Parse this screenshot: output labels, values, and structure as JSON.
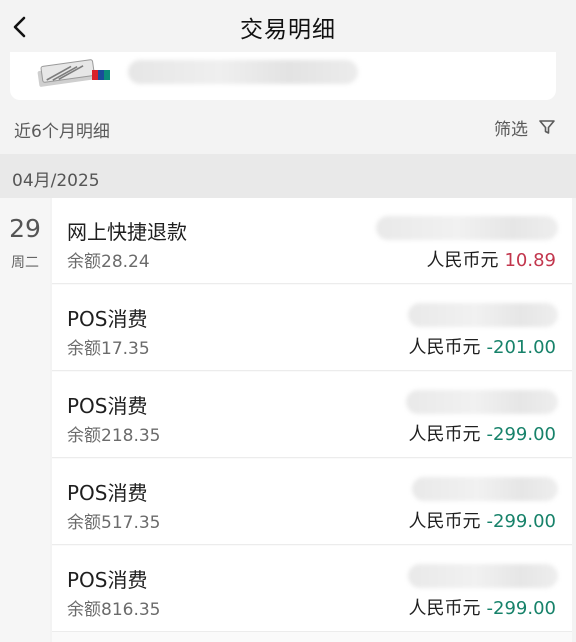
{
  "header": {
    "title": "交易明细"
  },
  "period": {
    "label": "近6个月明细",
    "filter_label": "筛选"
  },
  "month": {
    "label": "04月/2025"
  },
  "date": {
    "day": "29",
    "weekday": "周二"
  },
  "colors": {
    "income": "#c2364d",
    "expense": "#17826a"
  },
  "transactions": [
    {
      "title": "网上快捷退款",
      "balance": "余额28.24",
      "currency": "人民币元",
      "amount": "10.89",
      "type": "income"
    },
    {
      "title": "POS消费",
      "balance": "余额17.35",
      "currency": "人民币元",
      "amount": "-201.00",
      "type": "expense"
    },
    {
      "title": "POS消费",
      "balance": "余额218.35",
      "currency": "人民币元",
      "amount": "-299.00",
      "type": "expense"
    },
    {
      "title": "POS消费",
      "balance": "余额517.35",
      "currency": "人民币元",
      "amount": "-299.00",
      "type": "expense"
    },
    {
      "title": "POS消费",
      "balance": "余额816.35",
      "currency": "人民币元",
      "amount": "-299.00",
      "type": "expense"
    }
  ]
}
